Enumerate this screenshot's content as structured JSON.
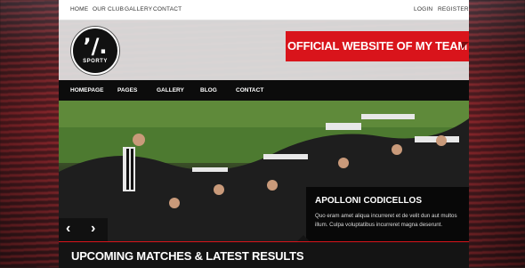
{
  "topbar": {
    "links": [
      "HOME",
      "OUR CLUB",
      "GALLERY",
      "CONTACT"
    ],
    "account": [
      "LOGIN",
      "REGISTER"
    ]
  },
  "logo": {
    "mark": "’/.",
    "text": "SPORTY"
  },
  "banner": {
    "text": "OFFICIAL WEBSITE OF MY TEAM"
  },
  "nav": {
    "items": [
      "HOMEPAGE",
      "PAGES",
      "GALLERY",
      "BLOG",
      "CONTACT"
    ]
  },
  "slider": {
    "caption_title": "APOLLONI CODICELLOS",
    "caption_text": "Quo eram amet aliqua incurreret et de velit dun aut multos illum. Culpa voluptatibus incurreret magna deserunt.",
    "prev_icon": "chevron-left-icon",
    "next_icon": "chevron-right-icon"
  },
  "section": {
    "title": "UPCOMING MATCHES & LATEST RESULTS"
  },
  "colors": {
    "accent": "#d9141b",
    "dark": "#0c0c0c"
  }
}
